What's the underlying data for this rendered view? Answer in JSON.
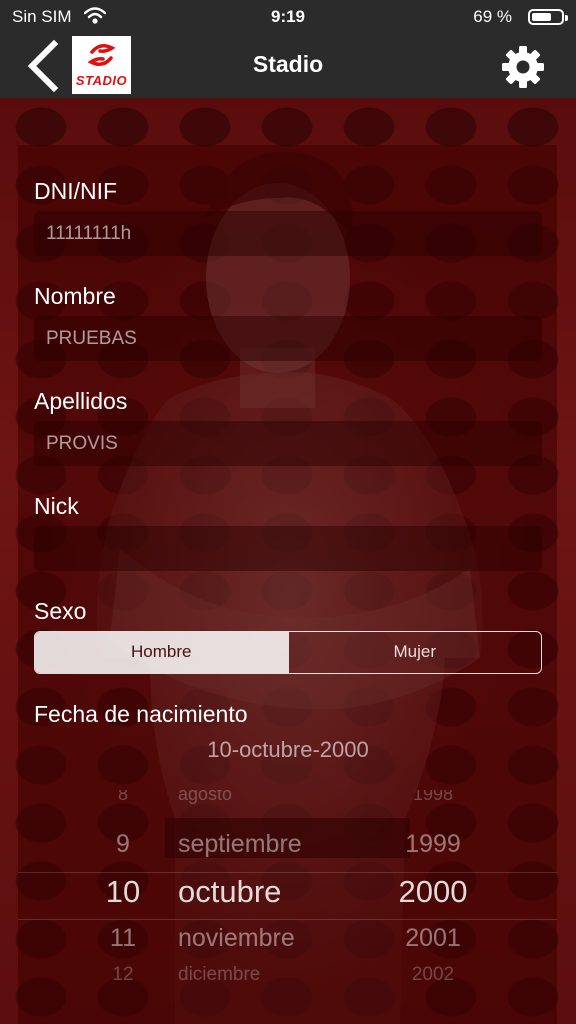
{
  "status": {
    "carrier": "Sin SIM",
    "time": "9:19",
    "battery_percent": "69 %",
    "battery_level": 0.69
  },
  "nav": {
    "title": "Stadio",
    "logo_text": "STADIO",
    "back_icon": "chevron-left-icon",
    "settings_icon": "gear-icon"
  },
  "form": {
    "dni": {
      "label": "DNI/NIF",
      "value": "11111111h"
    },
    "nombre": {
      "label": "Nombre",
      "value": "PRUEBAS"
    },
    "apellidos": {
      "label": "Apellidos",
      "value": "PROVIS"
    },
    "nick": {
      "label": "Nick",
      "value": ""
    },
    "sexo": {
      "label": "Sexo",
      "options": [
        "Hombre",
        "Mujer"
      ],
      "selected": "Hombre"
    },
    "fecha": {
      "label": "Fecha de nacimiento",
      "value": "10-octubre-2000"
    }
  },
  "picker": {
    "rows": [
      {
        "day": "8",
        "month": "agosto",
        "year": "1998"
      },
      {
        "day": "9",
        "month": "septiembre",
        "year": "1999"
      },
      {
        "day": "10",
        "month": "octubre",
        "year": "2000"
      },
      {
        "day": "11",
        "month": "noviembre",
        "year": "2001"
      },
      {
        "day": "12",
        "month": "diciembre",
        "year": "2002"
      }
    ],
    "selected_index": 2
  },
  "colors": {
    "bar": "#2b2b2b",
    "background": "#6e1414",
    "accent": "#d11111"
  }
}
